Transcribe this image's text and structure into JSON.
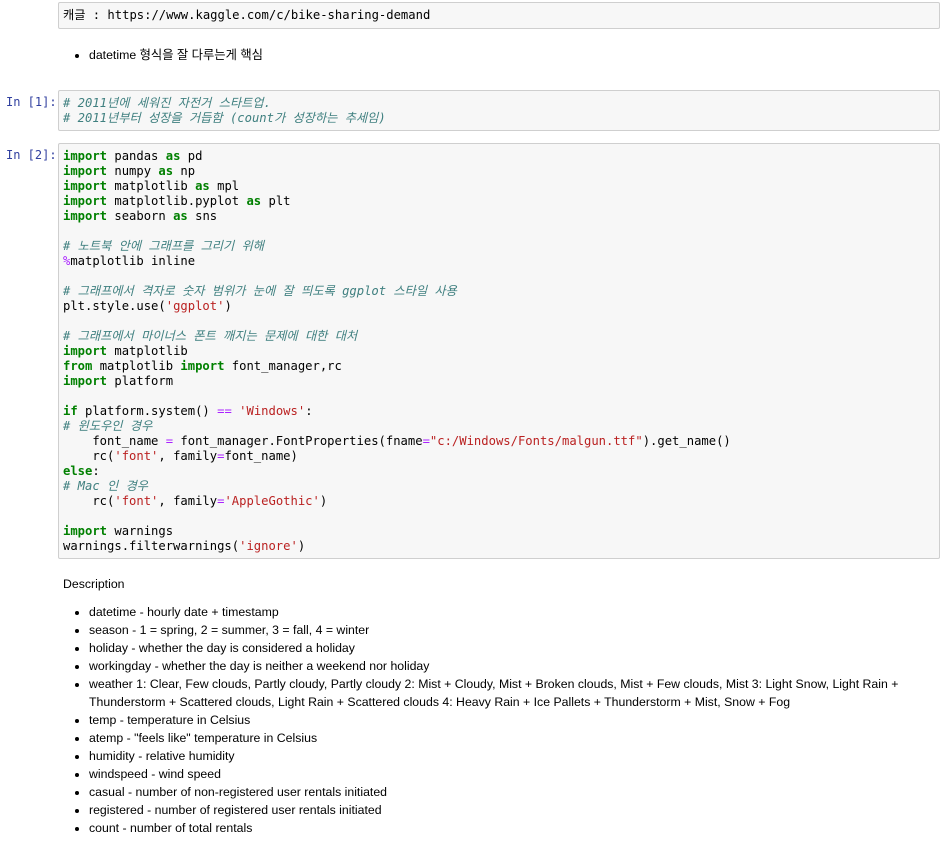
{
  "cells": {
    "raw_cell": {
      "text": "캐글 : https://www.kaggle.com/c/bike-sharing-demand"
    },
    "md_top": {
      "bullet": "datetime 형식을 잘 다루는게 핵심"
    },
    "cell1": {
      "prompt": "In [1]:",
      "lines": [
        "# 2011년에 세워진 자전거 스타트업.",
        "# 2011년부터 성장을 거듭함 (count가 성장하는 추세임)"
      ]
    },
    "cell2": {
      "prompt": "In [2]:",
      "lines": [
        "import pandas as pd",
        "import numpy as np",
        "import matplotlib as mpl",
        "import matplotlib.pyplot as plt",
        "import seaborn as sns",
        "",
        "# 노트북 안에 그래프를 그리기 위해",
        "%matplotlib inline",
        "",
        "# 그래프에서 격자로 숫자 범위가 눈에 잘 띄도록 ggplot 스타일 사용",
        "plt.style.use('ggplot')",
        "",
        "# 그래프에서 마이너스 폰트 깨지는 문제에 대한 대처",
        "import matplotlib",
        "from matplotlib import font_manager,rc",
        "import platform",
        "",
        "if platform.system() == 'Windows':",
        "# 윈도우인 경우",
        "    font_name = font_manager.FontProperties(fname=\"c:/Windows/Fonts/malgun.ttf\").get_name()",
        "    rc('font', family=font_name)",
        "else:",
        "# Mac 인 경우",
        "    rc('font', family='AppleGothic')",
        "",
        "import warnings",
        "warnings.filterwarnings('ignore')"
      ]
    },
    "description": {
      "heading": "Description",
      "items": [
        "datetime - hourly date + timestamp",
        "season - 1 = spring, 2 = summer, 3 = fall, 4 = winter",
        "holiday - whether the day is considered a holiday",
        "workingday - whether the day is neither a weekend nor holiday",
        "weather 1: Clear, Few clouds, Partly cloudy, Partly cloudy 2: Mist + Cloudy, Mist + Broken clouds, Mist + Few clouds, Mist 3: Light Snow, Light Rain + Thunderstorm + Scattered clouds, Light Rain + Scattered clouds 4: Heavy Rain + Ice Pallets + Thunderstorm + Mist, Snow + Fog",
        "temp - temperature in Celsius",
        "atemp - \"feels like\" temperature in Celsius",
        "humidity - relative humidity",
        "windspeed - wind speed",
        "casual - number of non-registered user rentals initiated",
        "registered - number of registered user rentals initiated",
        "count - number of total rentals"
      ]
    }
  },
  "colors": {
    "keyword": "#008000",
    "comment": "#408080",
    "string": "#ba2121",
    "operator": "#aa22ff",
    "prompt": "#303f9f"
  }
}
